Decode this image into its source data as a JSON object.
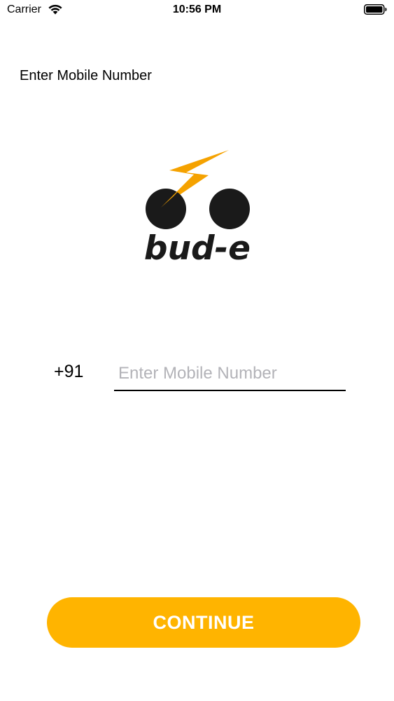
{
  "status_bar": {
    "carrier": "Carrier",
    "time": "10:56 PM",
    "wifi_icon": "wifi-icon",
    "battery_icon": "battery-icon"
  },
  "screen": {
    "title": "Enter Mobile Number"
  },
  "logo": {
    "text": "bud-e",
    "bolt_color": "#F5A200",
    "wheel_color": "#1A1A1A"
  },
  "form": {
    "country_code": "+91",
    "mobile_placeholder": "Enter Mobile Number",
    "mobile_value": ""
  },
  "actions": {
    "continue_label": "CONTINUE",
    "continue_color": "#FFB400"
  }
}
